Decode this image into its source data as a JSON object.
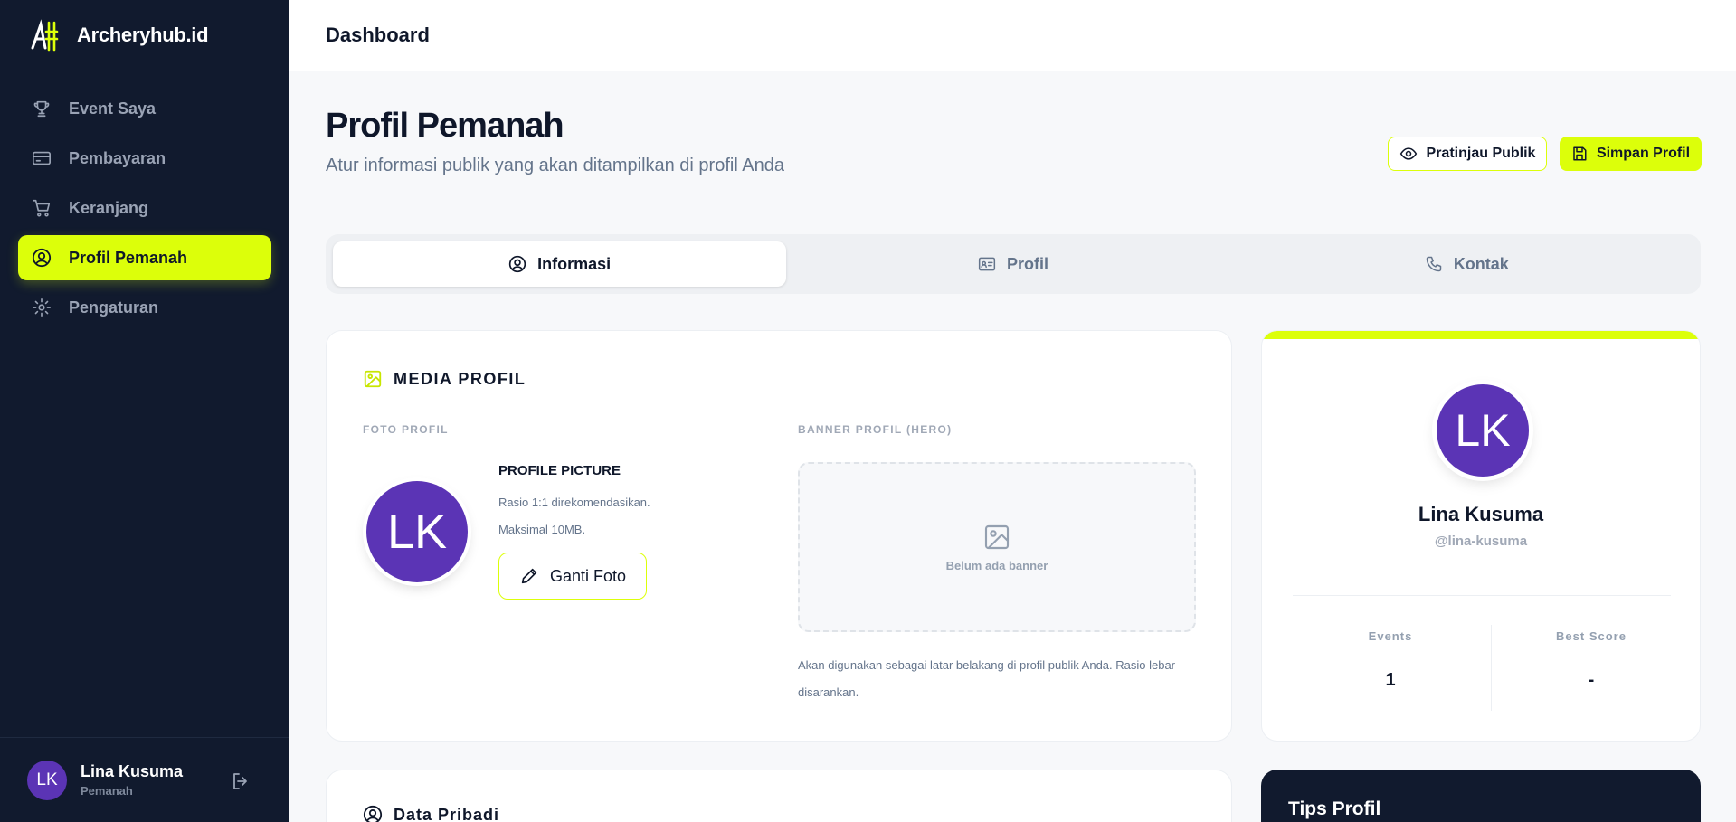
{
  "app": {
    "brand_name": "Archeryhub.id",
    "brand_color": "#dcff0a",
    "sidebar_color": "#111a2e"
  },
  "sidebar": {
    "items": [
      {
        "label": "Event Saya",
        "icon": "trophy-icon"
      },
      {
        "label": "Pembayaran",
        "icon": "credit-card-icon"
      },
      {
        "label": "Keranjang",
        "icon": "cart-icon"
      },
      {
        "label": "Profil Pemanah",
        "icon": "user-circle-icon",
        "active": true
      },
      {
        "label": "Pengaturan",
        "icon": "gear-icon"
      }
    ],
    "user": {
      "initials": "LK",
      "name": "Lina Kusuma",
      "role": "Pemanah"
    }
  },
  "topbar": {
    "title": "Dashboard"
  },
  "header": {
    "title": "Profil Pemanah",
    "subtitle": "Atur informasi publik yang akan ditampilkan di profil Anda",
    "preview_label": "Pratinjau Publik",
    "save_label": "Simpan Profil"
  },
  "tabs": [
    {
      "label": "Informasi",
      "icon": "user-circle-icon",
      "active": true
    },
    {
      "label": "Profil",
      "icon": "id-card-icon"
    },
    {
      "label": "Kontak",
      "icon": "phone-icon"
    }
  ],
  "media": {
    "section_title": "MEDIA PROFIL",
    "photo_label": "FOTO PROFIL",
    "banner_label": "BANNER PROFIL (HERO)",
    "avatar_initials": "LK",
    "picture_title": "PROFILE PICTURE",
    "picture_note_1": "Rasio 1:1 direkomendasikan.",
    "picture_note_2": "Maksimal 10MB.",
    "change_photo_label": "Ganti Foto",
    "banner_empty": "Belum ada banner",
    "banner_note": "Akan digunakan sebagai latar belakang di profil publik Anda. Rasio lebar disarankan."
  },
  "profile_card": {
    "initials": "LK",
    "name": "Lina Kusuma",
    "handle": "@lina-kusuma",
    "stats": [
      {
        "label": "Events",
        "value": "1"
      },
      {
        "label": "Best Score",
        "value": "-"
      }
    ]
  },
  "data_section": {
    "title": "Data Pribadi"
  },
  "tips": {
    "title": "Tips Profil"
  }
}
